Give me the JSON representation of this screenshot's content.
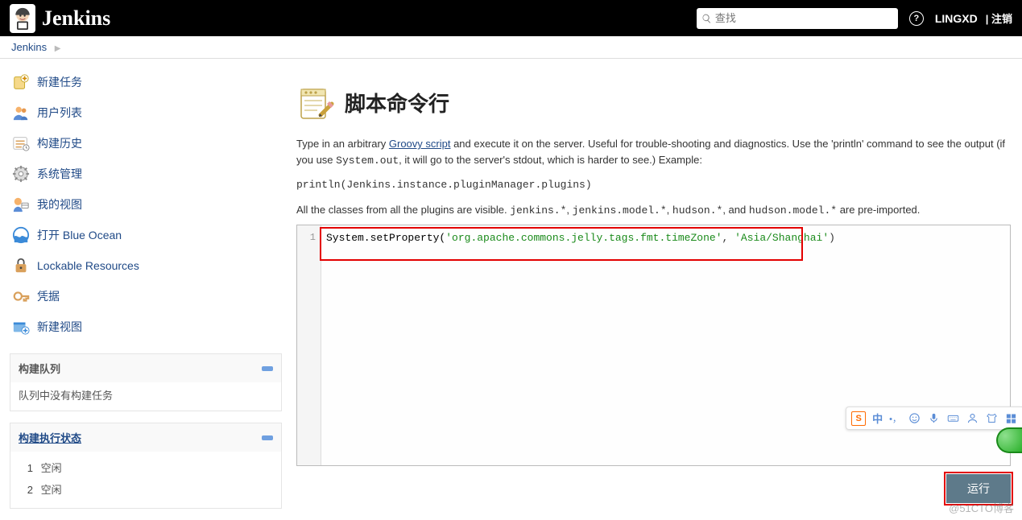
{
  "header": {
    "brand": "Jenkins",
    "search_placeholder": "查找",
    "user": "LINGXD",
    "logout": "注销"
  },
  "breadcrumb": {
    "root": "Jenkins"
  },
  "sidebar": {
    "items": [
      {
        "label": "新建任务",
        "icon": "new-item-icon"
      },
      {
        "label": "用户列表",
        "icon": "people-icon"
      },
      {
        "label": "构建历史",
        "icon": "build-history-icon"
      },
      {
        "label": "系统管理",
        "icon": "manage-icon"
      },
      {
        "label": "我的视图",
        "icon": "my-views-icon"
      },
      {
        "label": "打开 Blue Ocean",
        "icon": "blueocean-icon"
      },
      {
        "label": "Lockable Resources",
        "icon": "lock-icon"
      },
      {
        "label": "凭据",
        "icon": "credentials-icon"
      },
      {
        "label": "新建视图",
        "icon": "new-view-icon"
      }
    ],
    "build_queue": {
      "title": "构建队列",
      "empty_text": "队列中没有构建任务"
    },
    "executors": {
      "title": "构建执行状态",
      "rows": [
        {
          "num": "1",
          "status": "空闲"
        },
        {
          "num": "2",
          "status": "空闲"
        }
      ]
    }
  },
  "main": {
    "title": "脚本命令行",
    "desc_prefix": "Type in an arbitrary ",
    "groovy_link": "Groovy script",
    "desc_mid": " and execute it on the server. Useful for trouble-shooting and diagnostics. Use the 'println' command to see the output (if you use ",
    "system_out": "System.out",
    "desc_suffix": ", it will go to the server's stdout, which is harder to see.) Example:",
    "example_code": "println(Jenkins.instance.pluginManager.plugins)",
    "classes_prefix": "All the classes from all the plugins are visible. ",
    "classes_pkg1": "jenkins.*",
    "classes_sep": ", ",
    "classes_pkg2": "jenkins.model.*",
    "classes_pkg3": "hudson.*",
    "classes_and": ", and ",
    "classes_pkg4": "hudson.model.*",
    "classes_suffix": " are pre-imported.",
    "gutter_1": "1",
    "code_func": "System.setProperty(",
    "code_arg1": "'org.apache.commons.jelly.tags.fmt.timeZone'",
    "code_comma": ", ",
    "code_arg2": "'Asia/Shanghai'",
    "code_close": ")",
    "run_label": "运行"
  },
  "ime": {
    "logo": "S",
    "zh": "中",
    "punc": "•，"
  },
  "watermark": "@51CTO博客"
}
